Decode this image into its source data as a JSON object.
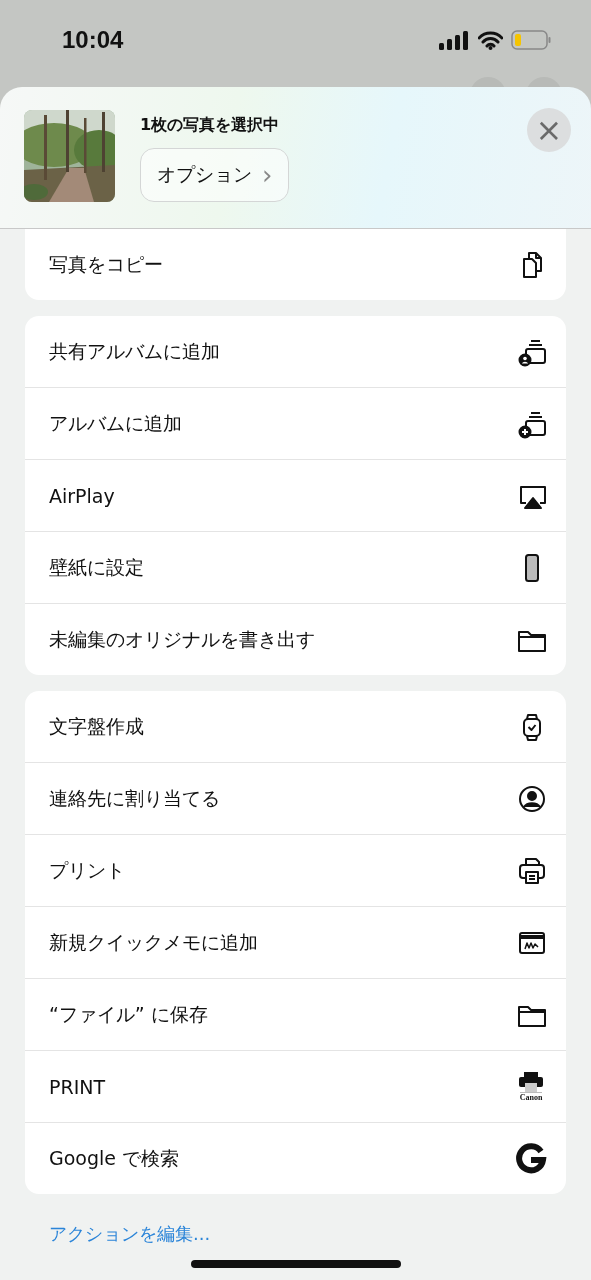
{
  "status_bar": {
    "time": "10:04"
  },
  "share_sheet": {
    "title": "1枚の写真を選択中",
    "options_button": "オプション",
    "chevron": "›",
    "close_button": "×"
  },
  "groups": [
    {
      "items": [
        {
          "label": "写真をコピー",
          "kind": "copy"
        }
      ]
    },
    {
      "items": [
        {
          "label": "共有アルバムに追加",
          "kind": "shared-album"
        },
        {
          "label": "アルバムに追加",
          "kind": "album"
        },
        {
          "label": "AirPlay",
          "kind": "airplay"
        },
        {
          "label": "壁紙に設定",
          "kind": "wallpaper"
        },
        {
          "label": "未編集のオリジナルを書き出す",
          "kind": "folder"
        }
      ]
    },
    {
      "items": [
        {
          "label": "文字盤作成",
          "kind": "watch"
        },
        {
          "label": "連絡先に割り当てる",
          "kind": "contact"
        },
        {
          "label": "プリント",
          "kind": "printer"
        },
        {
          "label": "新規クイックメモに追加",
          "kind": "note"
        },
        {
          "label": "“ファイル” に保存",
          "kind": "folder"
        },
        {
          "label": "PRINT",
          "kind": "canon",
          "icon_label": "Canon"
        },
        {
          "label": "Google で検索",
          "kind": "google"
        }
      ]
    }
  ],
  "edit_actions_link": "アクションを編集..."
}
